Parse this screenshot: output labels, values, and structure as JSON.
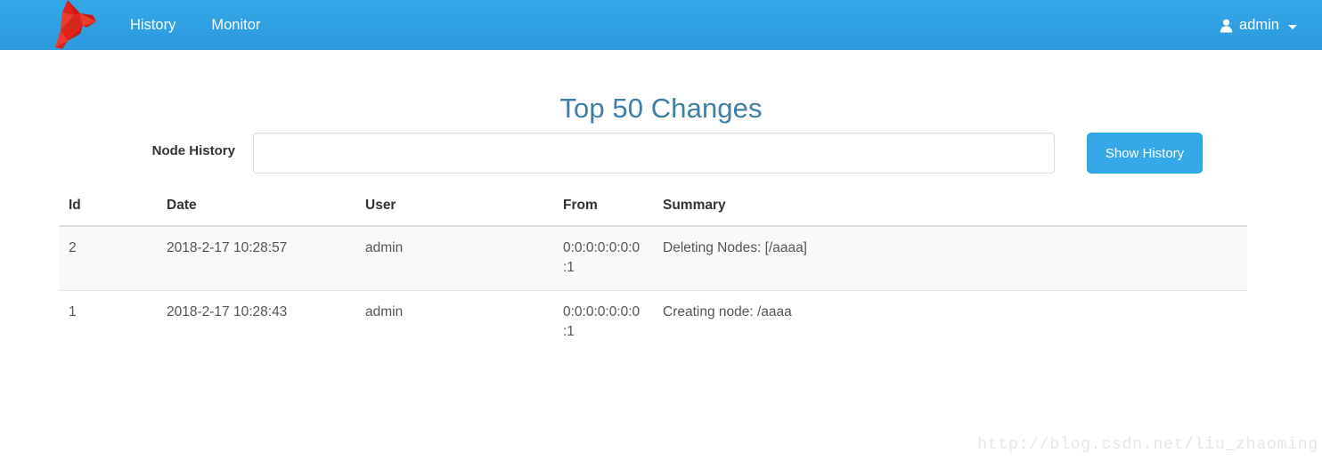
{
  "navbar": {
    "brand_icon": "zookeeper-bird-logo",
    "brand_color": "#e02020",
    "background_color": "#35a8e8",
    "links": [
      {
        "label": "History",
        "name": "history"
      },
      {
        "label": "Monitor",
        "name": "monitor"
      }
    ],
    "user": {
      "icon": "user-icon",
      "name": "admin",
      "caret": "chevron-down-icon"
    }
  },
  "main": {
    "title": "Top 50 Changes",
    "title_color": "#3d7da6",
    "form": {
      "label": "Node History",
      "input_value": "",
      "input_placeholder": "",
      "button_label": "Show History",
      "button_color": "#35a9e8"
    },
    "table": {
      "headers": [
        "Id",
        "Date",
        "User",
        "From",
        "Summary"
      ],
      "rows": [
        {
          "id": "2",
          "date": "2018-2-17 10:28:57",
          "user": "admin",
          "from": "0:0:0:0:0:0:0:1",
          "summary": "Deleting Nodes: [/aaaa]"
        },
        {
          "id": "1",
          "date": "2018-2-17 10:28:43",
          "user": "admin",
          "from": "0:0:0:0:0:0:0:1",
          "summary": "Creating node: /aaaa"
        }
      ]
    }
  },
  "watermark": "http://blog.csdn.net/liu_zhaoming"
}
